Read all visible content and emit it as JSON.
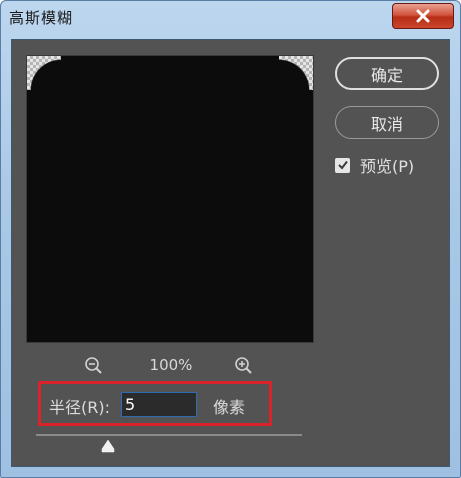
{
  "window": {
    "title": "高斯模糊"
  },
  "zoom": {
    "level": "100%"
  },
  "radius": {
    "label": "半径(R):",
    "value": "5",
    "unit": "像素",
    "slider_fraction": 0.27
  },
  "buttons": {
    "ok_label": "确定",
    "cancel_label": "取消"
  },
  "preview_option": {
    "label": "预览(P)",
    "checked": true
  },
  "icons": {
    "close": "close-icon",
    "zoom_out": "zoom-out-icon",
    "zoom_in": "zoom-in-icon",
    "check": "checkmark-icon",
    "slider_thumb": "triangle-thumb-icon"
  },
  "colors": {
    "dialog_bg": "#535353",
    "preview_bg": "#0c0c0c",
    "highlight_box": "#d9222a",
    "input_border": "#2f6bb3",
    "close_button": "#c9452b"
  }
}
